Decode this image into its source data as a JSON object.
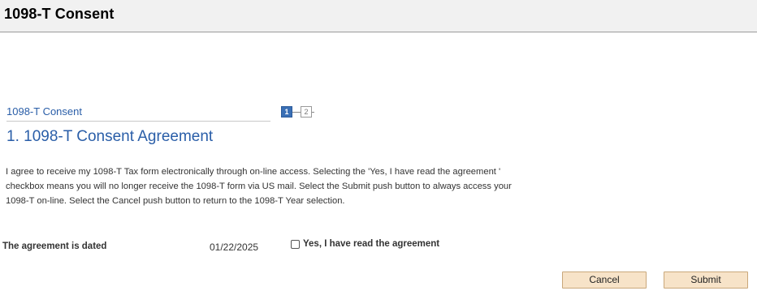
{
  "page": {
    "title": "1098-T Consent"
  },
  "step": {
    "title": "1098-T Consent",
    "heading": "1. 1098-T Consent Agreement",
    "nav": {
      "current": "1",
      "next": "2"
    }
  },
  "body_text": "I agree to receive my 1098-T Tax form electronically through on-line access. Selecting the 'Yes, I have read the agreement ' checkbox means you will no longer receive the 1098-T form via US mail.  Select the Submit push button to always access your 1098-T on-line. Select the Cancel push button to return to the 1098-T Year selection.",
  "agreement": {
    "label": "The agreement is dated",
    "date": "01/22/2025",
    "checkbox_label": "Yes, I have read the agreement",
    "checked": false
  },
  "buttons": {
    "cancel": "Cancel",
    "submit": "Submit"
  },
  "colors": {
    "header_bg": "#f1f1f1",
    "link_blue": "#2a5ea8",
    "button_bg": "#f7e3c8",
    "button_border": "#c9a77a"
  }
}
